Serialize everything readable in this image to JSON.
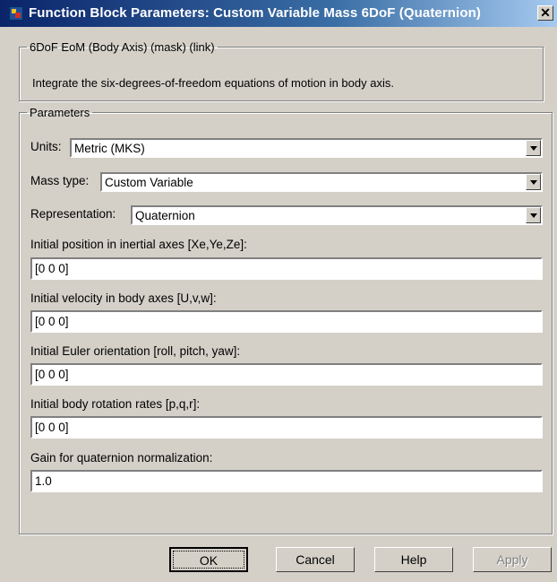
{
  "window": {
    "title": "Function Block Parameters: Custom Variable Mass 6DoF (Quaternion)",
    "close_glyph": "✕",
    "app_icon": "simulink-block-icon"
  },
  "mask": {
    "header": "6DoF EoM (Body Axis) (mask) (link)",
    "description": "Integrate the six-degrees-of-freedom equations of motion in body axis."
  },
  "parameters": {
    "legend": "Parameters",
    "units": {
      "label": "Units:",
      "value": "Metric (MKS)"
    },
    "mass_type": {
      "label": "Mass type:",
      "value": "Custom Variable"
    },
    "representation": {
      "label": "Representation:",
      "value": "Quaternion"
    },
    "initial_position": {
      "label": "Initial position in inertial axes [Xe,Ye,Ze]:",
      "value": "[0 0 0]"
    },
    "initial_velocity": {
      "label": "Initial velocity in body axes [U,v,w]:",
      "value": "[0 0 0]"
    },
    "initial_euler": {
      "label": "Initial Euler orientation [roll, pitch, yaw]:",
      "value": "[0 0 0]"
    },
    "initial_rates": {
      "label": "Initial body rotation rates [p,q,r]:",
      "value": "[0 0 0]"
    },
    "gain": {
      "label": "Gain for quaternion normalization:",
      "value": "1.0"
    }
  },
  "buttons": {
    "ok": "OK",
    "cancel": "Cancel",
    "help": "Help",
    "apply": "Apply"
  }
}
